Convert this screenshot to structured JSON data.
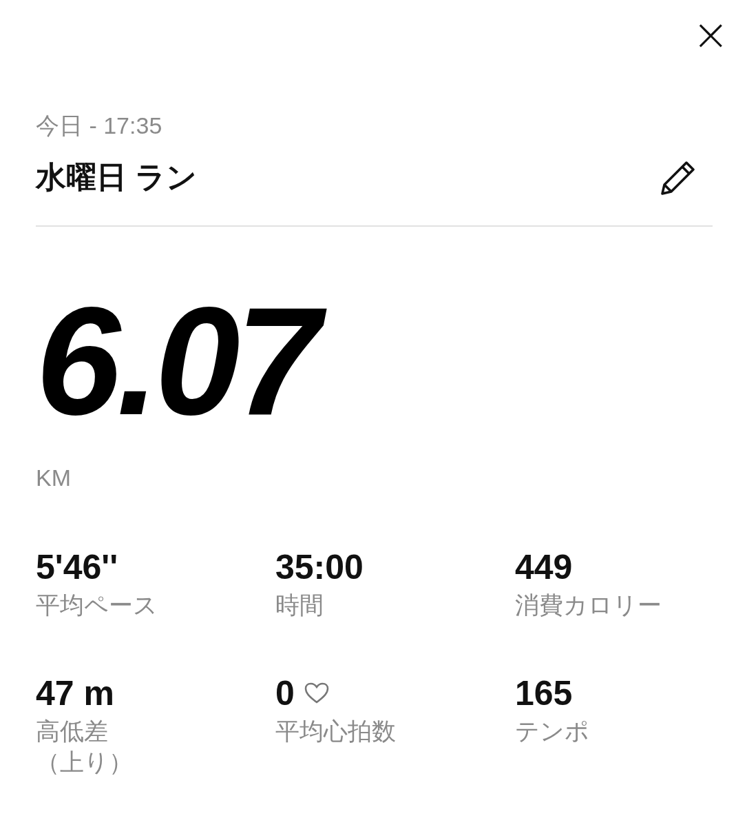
{
  "header": {
    "close": "×"
  },
  "activity": {
    "date": "今日 - 17:35",
    "title": "水曜日 ラン"
  },
  "distance": {
    "value": "6.07",
    "unit": "KM"
  },
  "stats": [
    {
      "value": "5'46''",
      "label": "平均ペース",
      "kind": "plain"
    },
    {
      "value": "35:00",
      "label": "時間",
      "kind": "plain"
    },
    {
      "value": "449",
      "label": "消費カロリー",
      "kind": "plain"
    },
    {
      "value": "47 m",
      "label": "高低差",
      "note": "（上り）",
      "kind": "plain"
    },
    {
      "value": "0",
      "label": "平均心拍数",
      "kind": "heart"
    },
    {
      "value": "165",
      "label": "テンポ",
      "kind": "plain"
    }
  ]
}
